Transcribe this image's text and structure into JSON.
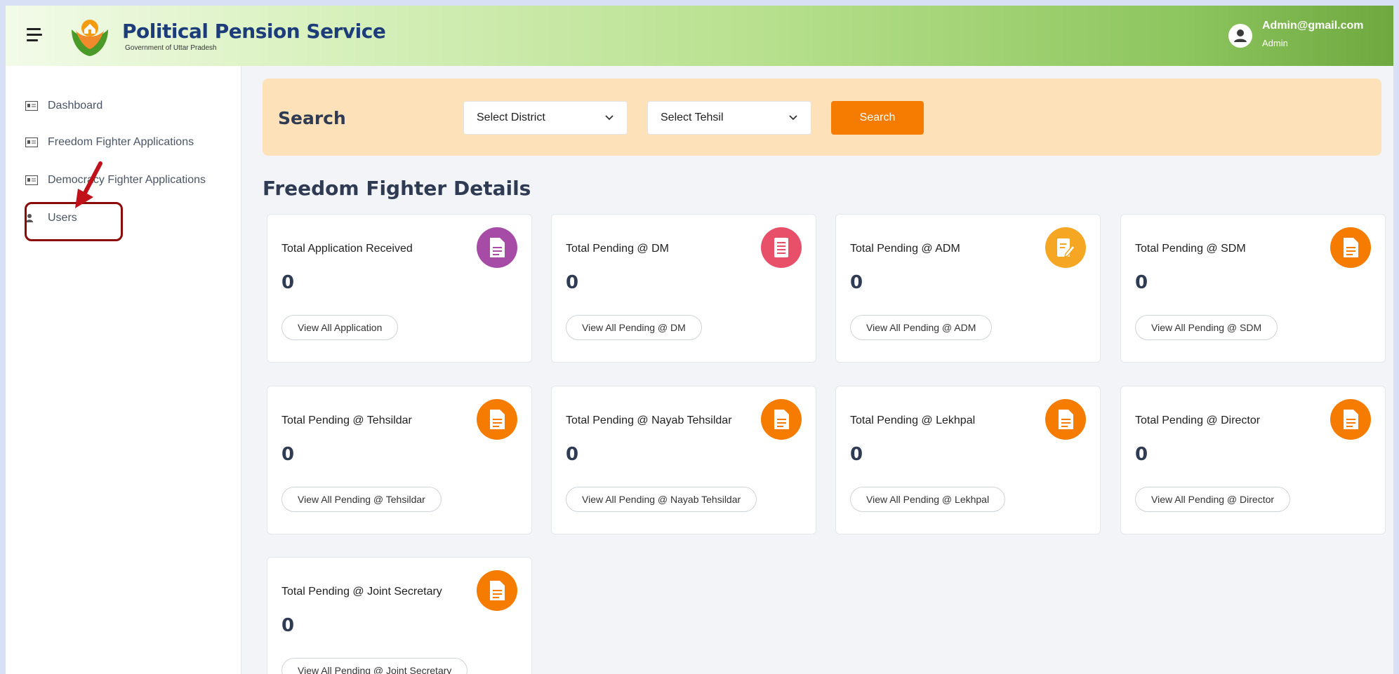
{
  "header": {
    "title": "Political Pension Service",
    "subtitle": "Government of Uttar Pradesh",
    "user_email": "Admin@gmail.com",
    "user_role": "Admin"
  },
  "sidebar": {
    "items": [
      {
        "label": "Dashboard",
        "icon": "id-card-icon"
      },
      {
        "label": "Freedom Fighter Applications",
        "icon": "id-card-icon"
      },
      {
        "label": "Democracy Fighter Applications",
        "icon": "id-card-icon"
      },
      {
        "label": "Users",
        "icon": "user-icon"
      }
    ]
  },
  "search": {
    "title": "Search",
    "district_placeholder": "Select District",
    "tehsil_placeholder": "Select Tehsil",
    "button_label": "Search"
  },
  "section": {
    "title": "Freedom Fighter Details"
  },
  "cards": [
    {
      "label": "Total Application Received",
      "count": "0",
      "button": "View All Application",
      "color": "#a64ca6"
    },
    {
      "label": "Total Pending @ DM",
      "count": "0",
      "button": "View All Pending @ DM",
      "color": "#e8506a"
    },
    {
      "label": "Total Pending @ ADM",
      "count": "0",
      "button": "View All Pending @ ADM",
      "color": "#f5a623"
    },
    {
      "label": "Total Pending @ SDM",
      "count": "0",
      "button": "View All Pending @ SDM",
      "color": "#f57c00"
    },
    {
      "label": "Total Pending @ Tehsildar",
      "count": "0",
      "button": "View All Pending @ Tehsildar",
      "color": "#f57c00"
    },
    {
      "label": "Total Pending @ Nayab Tehsildar",
      "count": "0",
      "button": "View All Pending @ Nayab Tehsildar",
      "color": "#f57c00"
    },
    {
      "label": "Total Pending @ Lekhpal",
      "count": "0",
      "button": "View All Pending @ Lekhpal",
      "color": "#f57c00"
    },
    {
      "label": "Total Pending @ Director",
      "count": "0",
      "button": "View All Pending @ Director",
      "color": "#f57c00"
    },
    {
      "label": "Total Pending @ Joint Secretary",
      "count": "0",
      "button": "View All Pending @ Joint Secretary",
      "color": "#f57c00"
    }
  ],
  "colors": {
    "accent": "#f57c00",
    "search_bg": "#fde2b9",
    "annotation": "#8b0a0a"
  }
}
